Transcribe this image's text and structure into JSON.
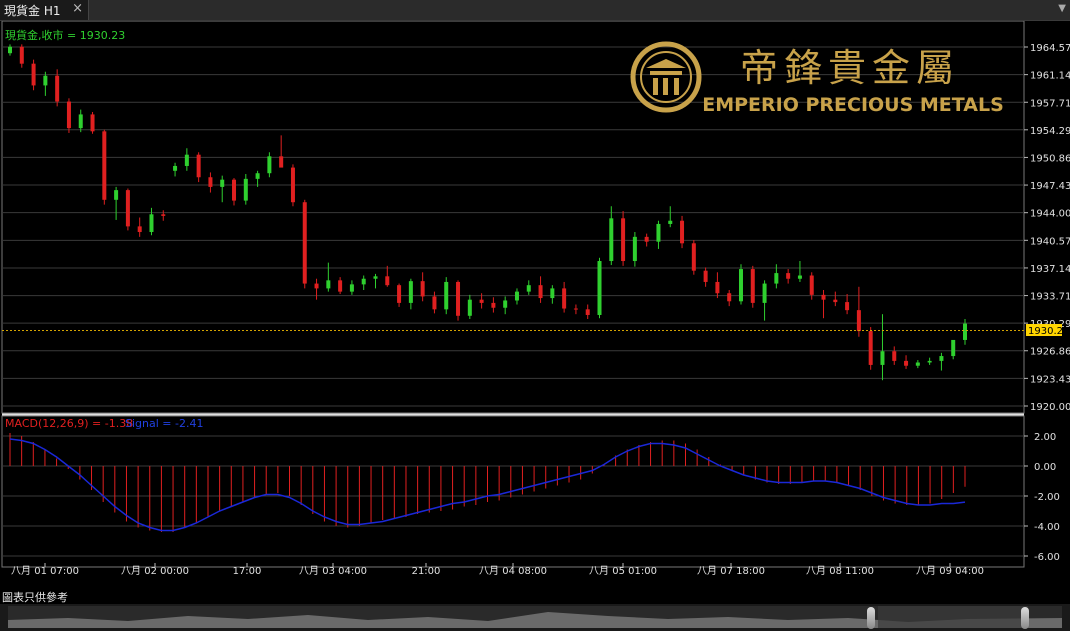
{
  "window": {
    "tab_label": "現貨金 H1",
    "close_icon": "×",
    "menu_icon": "▼"
  },
  "main_pane": {
    "header": "現貨金,收市 = 1930.23",
    "price_tag": "1930.23",
    "price_ticks": [
      "1964.57",
      "1961.14",
      "1957.71",
      "1954.29",
      "1950.86",
      "1947.43",
      "1944.00",
      "1940.57",
      "1937.14",
      "1933.71",
      "1930.29",
      "1926.86",
      "1923.43",
      "1920.00"
    ]
  },
  "logo": {
    "cn_text": "帝鋒貴金屬",
    "en_text": "EMPERIO PRECIOUS METALS"
  },
  "macd_pane": {
    "label": "MACD(12,26,9) = -1.38",
    "signal_label": "Signal = -2.41",
    "ticks": [
      "2.00",
      "0.00",
      "-2.00",
      "-4.00",
      "-6.00"
    ]
  },
  "time_labels": [
    "八月 01 07:00",
    "八月 02 00:00",
    "17:00",
    "八月 03 04:00",
    "21:00",
    "八月 04 08:00",
    "八月 05 01:00",
    "八月 07 18:00",
    "八月 08 11:00",
    "八月 09 04:00"
  ],
  "footnote": "圖表只供參考",
  "colors": {
    "up": "#2fd02f",
    "down": "#e02020",
    "signal": "#1a28d8",
    "price_line": "#d4a400",
    "gold": "#c8a24a"
  },
  "chart_data": {
    "type": "candlestick",
    "symbol": "現貨金",
    "timeframe": "H1",
    "last_close": 1930.23,
    "ylim": [
      1920.0,
      1964.57
    ],
    "ohlc_per_bar_sampled": [
      [
        1963.8,
        1964.9,
        1963.5,
        1964.6
      ],
      [
        1964.6,
        1964.9,
        1962.0,
        1962.5
      ],
      [
        1962.5,
        1963.0,
        1959.2,
        1959.8
      ],
      [
        1959.8,
        1961.5,
        1958.5,
        1961.0
      ],
      [
        1961.0,
        1961.8,
        1957.2,
        1957.8
      ],
      [
        1957.8,
        1958.2,
        1953.9,
        1954.5
      ],
      [
        1954.5,
        1956.8,
        1954.0,
        1956.2
      ],
      [
        1956.2,
        1956.5,
        1953.8,
        1954.1
      ],
      [
        1954.1,
        1954.3,
        1945.0,
        1945.6
      ],
      [
        1945.6,
        1947.2,
        1943.1,
        1946.8
      ],
      [
        1946.8,
        1947.0,
        1941.8,
        1942.3
      ],
      [
        1942.3,
        1943.4,
        1941.0,
        1941.6
      ],
      [
        1941.6,
        1944.6,
        1941.2,
        1943.8
      ],
      [
        1943.8,
        1944.3,
        1943.0,
        1943.6
      ],
      [
        1949.2,
        1950.2,
        1948.5,
        1949.8
      ],
      [
        1949.8,
        1952.0,
        1949.2,
        1951.2
      ],
      [
        1951.2,
        1951.5,
        1947.8,
        1948.4
      ],
      [
        1948.4,
        1949.0,
        1946.5,
        1947.2
      ],
      [
        1947.2,
        1948.6,
        1945.3,
        1948.1
      ],
      [
        1948.1,
        1948.3,
        1944.9,
        1945.5
      ],
      [
        1945.5,
        1948.8,
        1945.0,
        1948.2
      ],
      [
        1948.2,
        1949.2,
        1947.2,
        1948.9
      ],
      [
        1948.9,
        1951.5,
        1948.4,
        1951.0
      ],
      [
        1951.0,
        1953.6,
        1950.7,
        1949.6
      ],
      [
        1949.6,
        1950.0,
        1944.8,
        1945.3
      ],
      [
        1945.3,
        1945.6,
        1934.6,
        1935.2
      ],
      [
        1935.2,
        1935.8,
        1933.2,
        1934.6
      ],
      [
        1934.6,
        1937.8,
        1934.2,
        1935.6
      ],
      [
        1935.6,
        1936.0,
        1933.9,
        1934.2
      ],
      [
        1934.2,
        1935.6,
        1933.8,
        1935.1
      ],
      [
        1935.1,
        1936.2,
        1934.4,
        1935.8
      ],
      [
        1935.8,
        1936.4,
        1934.6,
        1936.1
      ],
      [
        1936.1,
        1937.4,
        1934.8,
        1935.0
      ],
      [
        1935.0,
        1935.2,
        1932.3,
        1932.8
      ],
      [
        1932.8,
        1935.8,
        1932.0,
        1935.5
      ],
      [
        1935.5,
        1936.6,
        1933.0,
        1933.6
      ],
      [
        1933.6,
        1934.2,
        1931.5,
        1932.0
      ],
      [
        1932.0,
        1936.0,
        1931.4,
        1935.4
      ],
      [
        1935.4,
        1935.6,
        1930.6,
        1931.2
      ],
      [
        1931.2,
        1933.8,
        1930.8,
        1933.2
      ],
      [
        1933.2,
        1934.0,
        1932.1,
        1932.8
      ],
      [
        1932.8,
        1933.5,
        1931.6,
        1932.2
      ],
      [
        1932.2,
        1933.6,
        1931.4,
        1933.1
      ],
      [
        1933.1,
        1934.6,
        1932.6,
        1934.2
      ],
      [
        1934.2,
        1935.6,
        1933.8,
        1935.0
      ],
      [
        1935.0,
        1936.1,
        1932.8,
        1933.4
      ],
      [
        1933.4,
        1935.0,
        1932.7,
        1934.6
      ],
      [
        1934.6,
        1935.4,
        1931.6,
        1932.1
      ],
      [
        1932.1,
        1932.6,
        1931.4,
        1932.0
      ],
      [
        1932.0,
        1932.6,
        1930.8,
        1931.3
      ],
      [
        1931.3,
        1938.4,
        1930.9,
        1938.0
      ],
      [
        1938.0,
        1944.8,
        1937.5,
        1943.3
      ],
      [
        1943.3,
        1944.2,
        1937.4,
        1938.0
      ],
      [
        1938.0,
        1941.6,
        1937.3,
        1941.0
      ],
      [
        1941.0,
        1941.4,
        1939.8,
        1940.4
      ],
      [
        1940.4,
        1943.0,
        1939.5,
        1942.6
      ],
      [
        1942.6,
        1944.8,
        1942.2,
        1943.0
      ],
      [
        1943.0,
        1943.6,
        1939.6,
        1940.2
      ],
      [
        1940.2,
        1940.6,
        1936.3,
        1936.8
      ],
      [
        1936.8,
        1937.2,
        1934.8,
        1935.4
      ],
      [
        1935.4,
        1936.6,
        1933.4,
        1934.0
      ],
      [
        1934.0,
        1934.4,
        1932.4,
        1933.0
      ],
      [
        1933.0,
        1937.6,
        1932.6,
        1937.0
      ],
      [
        1937.0,
        1937.4,
        1932.2,
        1932.8
      ],
      [
        1932.8,
        1935.6,
        1930.6,
        1935.2
      ],
      [
        1935.2,
        1937.6,
        1934.6,
        1936.5
      ],
      [
        1936.5,
        1937.0,
        1935.2,
        1935.8
      ],
      [
        1935.8,
        1938.0,
        1935.4,
        1936.2
      ],
      [
        1936.2,
        1936.6,
        1933.2,
        1933.8
      ],
      [
        1933.8,
        1934.4,
        1930.9,
        1933.2
      ],
      [
        1933.2,
        1934.2,
        1932.4,
        1932.9
      ],
      [
        1932.9,
        1933.9,
        1931.4,
        1931.9
      ],
      [
        1931.9,
        1934.8,
        1928.6,
        1929.3
      ],
      [
        1929.3,
        1929.8,
        1924.5,
        1925.1
      ],
      [
        1925.1,
        1931.4,
        1923.2,
        1926.8
      ],
      [
        1926.8,
        1927.4,
        1925.1,
        1925.6
      ],
      [
        1925.6,
        1926.3,
        1924.6,
        1925.0
      ],
      [
        1925.0,
        1925.7,
        1924.7,
        1925.4
      ],
      [
        1925.4,
        1926.0,
        1925.1,
        1925.6
      ],
      [
        1925.6,
        1926.6,
        1924.4,
        1926.2
      ],
      [
        1926.2,
        1928.0,
        1925.8,
        1928.2
      ],
      [
        1928.2,
        1930.8,
        1927.6,
        1930.23
      ]
    ],
    "macd_histogram_sampled": [
      2.2,
      2.0,
      1.6,
      1.1,
      0.5,
      -0.2,
      -0.9,
      -1.6,
      -2.4,
      -3.1,
      -3.7,
      -4.1,
      -4.3,
      -4.4,
      -4.4,
      -4.1,
      -3.8,
      -3.4,
      -3.0,
      -2.7,
      -2.4,
      -2.1,
      -1.9,
      -1.8,
      -2.0,
      -2.6,
      -3.2,
      -3.7,
      -4.0,
      -4.1,
      -4.0,
      -3.8,
      -3.6,
      -3.5,
      -3.4,
      -3.2,
      -3.1,
      -3.0,
      -2.9,
      -2.7,
      -2.6,
      -2.4,
      -2.3,
      -2.1,
      -1.9,
      -1.7,
      -1.5,
      -1.3,
      -1.1,
      -0.9,
      -0.5,
      0.1,
      0.7,
      1.1,
      1.4,
      1.6,
      1.7,
      1.7,
      1.5,
      1.1,
      0.6,
      0.1,
      -0.3,
      -0.6,
      -0.9,
      -1.1,
      -1.2,
      -1.2,
      -1.1,
      -1.0,
      -1.0,
      -1.1,
      -1.3,
      -1.6,
      -2.0,
      -2.3,
      -2.5,
      -2.6,
      -2.6,
      -2.5,
      -2.2,
      -1.8,
      -1.38
    ],
    "macd_signal_sampled": [
      1.8,
      1.7,
      1.5,
      1.1,
      0.6,
      0.0,
      -0.6,
      -1.3,
      -2.0,
      -2.7,
      -3.3,
      -3.8,
      -4.1,
      -4.3,
      -4.3,
      -4.1,
      -3.8,
      -3.4,
      -3.0,
      -2.7,
      -2.4,
      -2.1,
      -1.9,
      -1.9,
      -2.1,
      -2.5,
      -3.0,
      -3.4,
      -3.7,
      -3.9,
      -3.9,
      -3.8,
      -3.7,
      -3.5,
      -3.3,
      -3.1,
      -2.9,
      -2.7,
      -2.5,
      -2.4,
      -2.2,
      -2.0,
      -1.9,
      -1.7,
      -1.5,
      -1.3,
      -1.1,
      -0.9,
      -0.7,
      -0.5,
      -0.3,
      0.1,
      0.6,
      1.0,
      1.3,
      1.5,
      1.5,
      1.4,
      1.2,
      0.8,
      0.4,
      0.0,
      -0.3,
      -0.6,
      -0.8,
      -1.0,
      -1.1,
      -1.1,
      -1.1,
      -1.0,
      -1.0,
      -1.1,
      -1.3,
      -1.5,
      -1.8,
      -2.1,
      -2.3,
      -2.5,
      -2.6,
      -2.6,
      -2.5,
      -2.5,
      -2.41
    ],
    "macd_ylim": [
      -6,
      2
    ]
  }
}
